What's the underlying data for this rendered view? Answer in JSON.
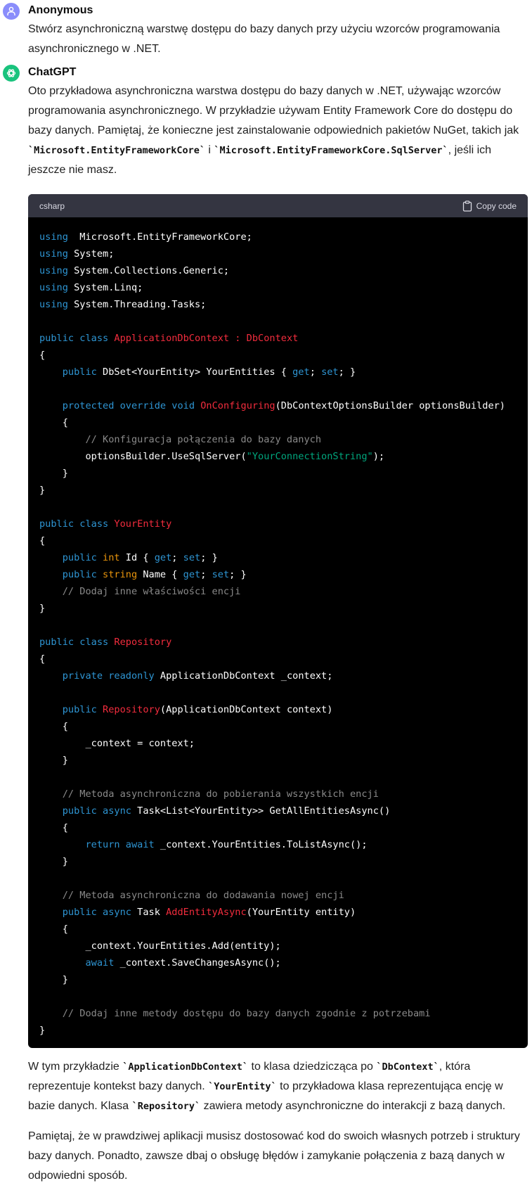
{
  "user_message": {
    "author": "Anonymous",
    "avatar_icon": "user-icon",
    "text": "Stwórz asynchroniczną warstwę dostępu do bazy danych przy użyciu wzorców programowania asynchronicznego w .NET."
  },
  "assistant_message": {
    "author": "ChatGPT",
    "avatar_icon": "openai-logo-icon",
    "intro": {
      "part1": "Oto przykładowa asynchroniczna warstwa dostępu do bazy danych w .NET, używając wzorców programowania asynchronicznego. W przykładzie używam Entity Framework Core do dostępu do bazy danych. Pamiętaj, że konieczne jest zainstalowanie odpowiednich pakietów NuGet, takich jak ",
      "code1": "`Microsoft.EntityFrameworkCore`",
      "part2": " i ",
      "code2": "`Microsoft.EntityFrameworkCore.SqlServer`",
      "part3": ", jeśli ich jeszcze nie masz."
    },
    "code_block": {
      "language": "csharp",
      "copy_label": "Copy code",
      "lines": [
        [
          [
            "kw",
            "using"
          ],
          [
            "",
            "  Microsoft.EntityFrameworkCore;"
          ]
        ],
        [
          [
            "kw",
            "using"
          ],
          [
            "",
            " System;"
          ]
        ],
        [
          [
            "kw",
            "using"
          ],
          [
            "",
            " System.Collections.Generic;"
          ]
        ],
        [
          [
            "kw",
            "using"
          ],
          [
            "",
            " System.Linq;"
          ]
        ],
        [
          [
            "kw",
            "using"
          ],
          [
            "",
            " System.Threading.Tasks;"
          ]
        ],
        [],
        [
          [
            "kw",
            "public"
          ],
          [
            "",
            " "
          ],
          [
            "kw",
            "class"
          ],
          [
            "",
            " "
          ],
          [
            "cls",
            "ApplicationDbContext"
          ],
          [
            "",
            " "
          ],
          [
            "cls",
            ":"
          ],
          [
            "",
            " "
          ],
          [
            "cls",
            "DbContext"
          ]
        ],
        [
          [
            "",
            "{"
          ]
        ],
        [
          [
            "",
            "    "
          ],
          [
            "kw",
            "public"
          ],
          [
            "",
            " DbSet<YourEntity> YourEntities { "
          ],
          [
            "kw",
            "get"
          ],
          [
            "",
            "; "
          ],
          [
            "kw",
            "set"
          ],
          [
            "",
            "; }"
          ]
        ],
        [],
        [
          [
            "",
            "    "
          ],
          [
            "kw",
            "protected"
          ],
          [
            "",
            " "
          ],
          [
            "kw",
            "override"
          ],
          [
            "",
            " "
          ],
          [
            "kw",
            "void"
          ],
          [
            "",
            " "
          ],
          [
            "cls",
            "OnConfiguring"
          ],
          [
            "",
            "(DbContextOptionsBuilder optionsBuilder)"
          ]
        ],
        [
          [
            "",
            "    {"
          ]
        ],
        [
          [
            "",
            "        "
          ],
          [
            "cm",
            "// Konfiguracja połączenia do bazy danych"
          ]
        ],
        [
          [
            "",
            "        optionsBuilder.UseSqlServer("
          ],
          [
            "str",
            "\"YourConnectionString\""
          ],
          [
            "",
            ");"
          ]
        ],
        [
          [
            "",
            "    }"
          ]
        ],
        [
          [
            "",
            "}"
          ]
        ],
        [],
        [
          [
            "kw",
            "public"
          ],
          [
            "",
            " "
          ],
          [
            "kw",
            "class"
          ],
          [
            "",
            " "
          ],
          [
            "cls",
            "YourEntity"
          ]
        ],
        [
          [
            "",
            "{"
          ]
        ],
        [
          [
            "",
            "    "
          ],
          [
            "kw",
            "public"
          ],
          [
            "",
            " "
          ],
          [
            "typ",
            "int"
          ],
          [
            "",
            " Id { "
          ],
          [
            "kw",
            "get"
          ],
          [
            "",
            "; "
          ],
          [
            "kw",
            "set"
          ],
          [
            "",
            "; }"
          ]
        ],
        [
          [
            "",
            "    "
          ],
          [
            "kw",
            "public"
          ],
          [
            "",
            " "
          ],
          [
            "typ",
            "string"
          ],
          [
            "",
            " Name { "
          ],
          [
            "kw",
            "get"
          ],
          [
            "",
            "; "
          ],
          [
            "kw",
            "set"
          ],
          [
            "",
            "; }"
          ]
        ],
        [
          [
            "",
            "    "
          ],
          [
            "cm",
            "// Dodaj inne właściwości encji"
          ]
        ],
        [
          [
            "",
            "}"
          ]
        ],
        [],
        [
          [
            "kw",
            "public"
          ],
          [
            "",
            " "
          ],
          [
            "kw",
            "class"
          ],
          [
            "",
            " "
          ],
          [
            "cls",
            "Repository"
          ]
        ],
        [
          [
            "",
            "{"
          ]
        ],
        [
          [
            "",
            "    "
          ],
          [
            "kw",
            "private"
          ],
          [
            "",
            " "
          ],
          [
            "kw",
            "readonly"
          ],
          [
            "",
            " ApplicationDbContext _context;"
          ]
        ],
        [],
        [
          [
            "",
            "    "
          ],
          [
            "kw",
            "public"
          ],
          [
            "",
            " "
          ],
          [
            "cls",
            "Repository"
          ],
          [
            "",
            "(ApplicationDbContext context)"
          ]
        ],
        [
          [
            "",
            "    {"
          ]
        ],
        [
          [
            "",
            "        _context = context;"
          ]
        ],
        [
          [
            "",
            "    }"
          ]
        ],
        [],
        [
          [
            "",
            "    "
          ],
          [
            "cm",
            "// Metoda asynchroniczna do pobierania wszystkich encji"
          ]
        ],
        [
          [
            "",
            "    "
          ],
          [
            "kw",
            "public"
          ],
          [
            "",
            " "
          ],
          [
            "kw",
            "async"
          ],
          [
            "",
            " Task<List<YourEntity>> GetAllEntitiesAsync()"
          ]
        ],
        [
          [
            "",
            "    {"
          ]
        ],
        [
          [
            "",
            "        "
          ],
          [
            "kw",
            "return"
          ],
          [
            "",
            " "
          ],
          [
            "kw",
            "await"
          ],
          [
            "",
            " _context.YourEntities.ToListAsync();"
          ]
        ],
        [
          [
            "",
            "    }"
          ]
        ],
        [],
        [
          [
            "",
            "    "
          ],
          [
            "cm",
            "// Metoda asynchroniczna do dodawania nowej encji"
          ]
        ],
        [
          [
            "",
            "    "
          ],
          [
            "kw",
            "public"
          ],
          [
            "",
            " "
          ],
          [
            "kw",
            "async"
          ],
          [
            "",
            " Task "
          ],
          [
            "cls",
            "AddEntityAsync"
          ],
          [
            "",
            "(YourEntity entity)"
          ]
        ],
        [
          [
            "",
            "    {"
          ]
        ],
        [
          [
            "",
            "        _context.YourEntities.Add(entity);"
          ]
        ],
        [
          [
            "",
            "        "
          ],
          [
            "kw",
            "await"
          ],
          [
            "",
            " _context.SaveChangesAsync();"
          ]
        ],
        [
          [
            "",
            "    }"
          ]
        ],
        [],
        [
          [
            "",
            "    "
          ],
          [
            "cm",
            "// Dodaj inne metody dostępu do bazy danych zgodnie z potrzebami"
          ]
        ],
        [
          [
            "",
            "}"
          ]
        ]
      ]
    },
    "outro1": {
      "p1": "W tym przykładzie ",
      "c1": "`ApplicationDbContext`",
      "p2": " to klasa dziedzicząca po ",
      "c2": "`DbContext`",
      "p3": ", która reprezentuje kontekst bazy danych. ",
      "c3": "`YourEntity`",
      "p4": " to przykładowa klasa reprezentująca encję w bazie danych. Klasa ",
      "c4": "`Repository`",
      "p5": " zawiera metody asynchroniczne do interakcji z bazą danych."
    },
    "outro2": "Pamiętaj, że w prawdziwej aplikacji musisz dostosować kod do swoich własnych potrzeb i struktury bazy danych. Ponadto, zawsze dbaj o obsługę błędów i zamykanie połączenia z bazą danych w odpowiedni sposób."
  }
}
